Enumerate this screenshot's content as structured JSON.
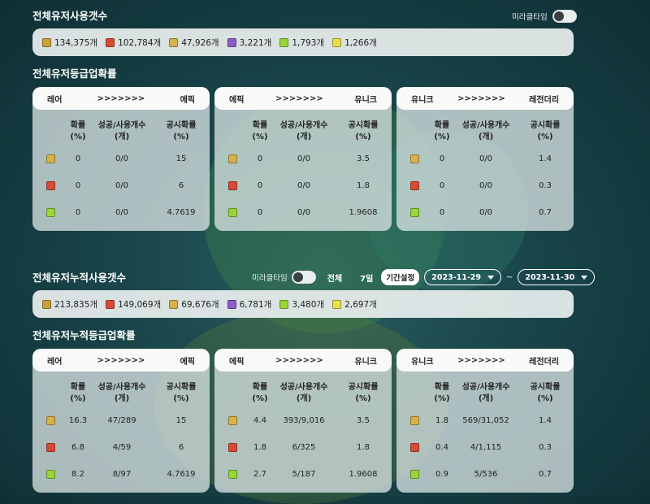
{
  "colors": {
    "rare": "#c9a23a",
    "epic": "#d94a35",
    "unique": "#d7b24a",
    "legendary": "#8c5cc8",
    "green": "#98d63a",
    "yellow": "#e8e04a"
  },
  "section1": {
    "title": "전체유저사용갯수",
    "toggle_label": "미라클타임",
    "counts": [
      "134,375개",
      "102,784개",
      "47,926개",
      "3,221개",
      "1,793개",
      "1,266개"
    ]
  },
  "section2": {
    "title": "전체유저등급업확률",
    "headers": {
      "rate": [
        "확률",
        "(%)"
      ],
      "success": [
        "성공/사용개수",
        "(개)"
      ],
      "official": [
        "공시확률",
        "(%)"
      ]
    },
    "panels": [
      {
        "from": "레어",
        "arrows": ">>>>>>>",
        "to": "에픽",
        "rows": [
          [
            "0",
            "0/0",
            "15"
          ],
          [
            "0",
            "0/0",
            "6"
          ],
          [
            "0",
            "0/0",
            "4.7619"
          ]
        ]
      },
      {
        "from": "에픽",
        "arrows": ">>>>>>>",
        "to": "유니크",
        "rows": [
          [
            "0",
            "0/0",
            "3.5"
          ],
          [
            "0",
            "0/0",
            "1.8"
          ],
          [
            "0",
            "0/0",
            "1.9608"
          ]
        ]
      },
      {
        "from": "유니크",
        "arrows": ">>>>>>>",
        "to": "레전더리",
        "rows": [
          [
            "0",
            "0/0",
            "1.4"
          ],
          [
            "0",
            "0/0",
            "0.3"
          ],
          [
            "0",
            "0/0",
            "0.7"
          ]
        ]
      }
    ]
  },
  "section3": {
    "title": "전체유저누적사용갯수",
    "toggle_label": "미라클타임",
    "filter_all": "전체",
    "filter_7d": "7일",
    "filter_period": "기간설정",
    "date_from": "2023-11-29",
    "date_sep": "~",
    "date_to": "2023-11-30",
    "counts": [
      "213,835개",
      "149,069개",
      "69,676개",
      "6,781개",
      "3,480개",
      "2,697개"
    ]
  },
  "section4": {
    "title": "전체유저누적등급업확률",
    "panels": [
      {
        "from": "레어",
        "arrows": ">>>>>>>",
        "to": "에픽",
        "rows": [
          [
            "16.3",
            "47/289",
            "15"
          ],
          [
            "6.8",
            "4/59",
            "6"
          ],
          [
            "8.2",
            "8/97",
            "4.7619"
          ]
        ]
      },
      {
        "from": "에픽",
        "arrows": ">>>>>>>",
        "to": "유니크",
        "rows": [
          [
            "4.4",
            "393/9,016",
            "3.5"
          ],
          [
            "1.8",
            "6/325",
            "1.8"
          ],
          [
            "2.7",
            "5/187",
            "1.9608"
          ]
        ]
      },
      {
        "from": "유니크",
        "arrows": ">>>>>>>",
        "to": "레전더리",
        "rows": [
          [
            "1.8",
            "569/31,052",
            "1.4"
          ],
          [
            "0.4",
            "4/1,115",
            "0.3"
          ],
          [
            "0.9",
            "5/536",
            "0.7"
          ]
        ]
      }
    ]
  }
}
